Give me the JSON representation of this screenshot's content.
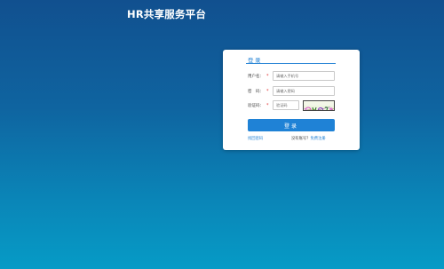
{
  "header": {
    "title": "HR共享服务平台"
  },
  "login": {
    "title": "登录",
    "username_label": "用户名：",
    "username_placeholder": "请输入手机号",
    "password_label": "密　码：",
    "password_placeholder": "请输入密码",
    "captcha_label": "验证码：",
    "captcha_placeholder": "验证码",
    "captcha_text": "7b9x",
    "required_mark": "*",
    "submit_label": "登录",
    "forgot_password": "找回密码",
    "no_account": "没有账号？",
    "register": "免费注册"
  },
  "colors": {
    "accent": "#1f82d6",
    "background_top": "#11508f",
    "background_bottom": "#069bc6",
    "required": "#e03030"
  }
}
